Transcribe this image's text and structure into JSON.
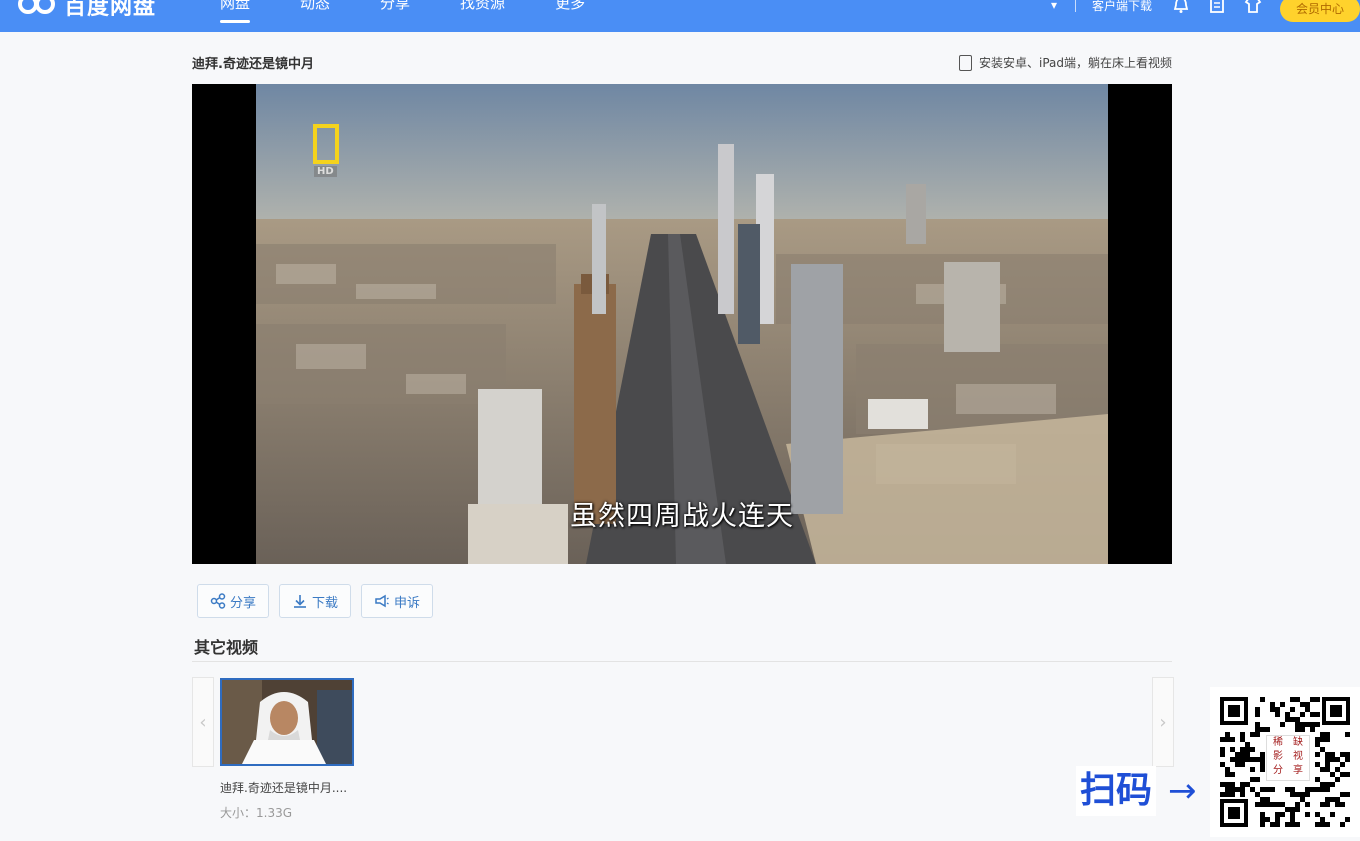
{
  "header": {
    "logo_text": "百度网盘",
    "nav": [
      "网盘",
      "动态",
      "分享",
      "找资源",
      "更多"
    ],
    "client_download": "客户端下载",
    "vip_label": "会员中心"
  },
  "video": {
    "title": "迪拜.奇迹还是镜中月",
    "install_hint": "安装安卓、iPad端，躺在床上看视频",
    "subtitle": "虽然四周战火连天",
    "channel_badge": "HD"
  },
  "actions": {
    "share": "分享",
    "download": "下载",
    "report": "申诉"
  },
  "other_videos": {
    "section_title": "其它视频",
    "items": [
      {
        "name": "迪拜.奇迹还是镜中月....",
        "size": "大小：1.33G"
      }
    ]
  },
  "promo": {
    "scan_label": "扫码",
    "arrow": "→",
    "qr_chars": [
      "稀",
      "缺",
      "影",
      "视",
      "分",
      "享"
    ]
  },
  "colors": {
    "topbar": "#4a8ef5",
    "accent": "#3b7ac4",
    "vip": "#ffd22c"
  }
}
